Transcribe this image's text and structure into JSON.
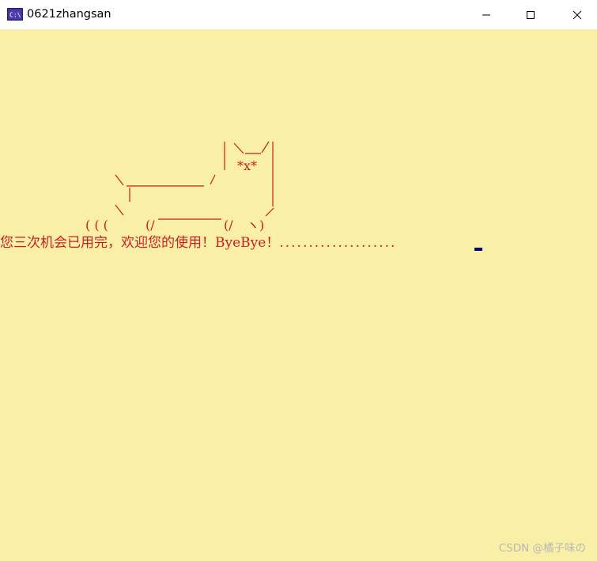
{
  "window": {
    "title": "0621zhangsan",
    "icon": "console-app-icon",
    "controls": [
      "minimize-icon",
      "maximize-icon",
      "close-icon"
    ]
  },
  "console": {
    "background_color": "#f9efa6",
    "text_color": "#c81e1e",
    "cursor_color": "#000080",
    "ascii_art": {
      "eyes": "*x*",
      "paws": "( ( (",
      "tail_bottom": "(/",
      "end": "ヽ)"
    },
    "message": {
      "text": "您三次机会已用完，欢迎您的使用！ByeBye！",
      "trailing": "...................."
    }
  },
  "watermark": "CSDN @橘子味の"
}
